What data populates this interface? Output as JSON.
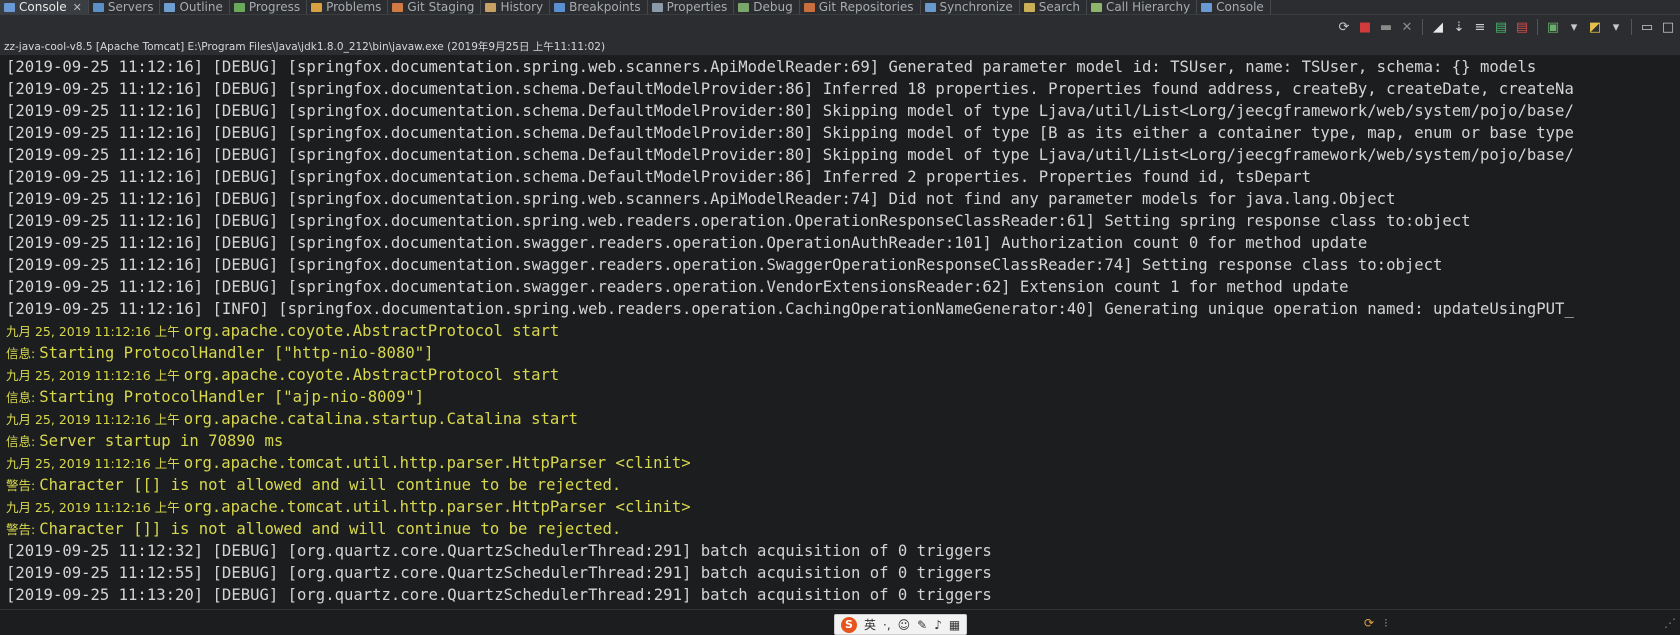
{
  "tabs": [
    {
      "label": "Console",
      "icon": "console-icon",
      "active": true,
      "color": "#6a9ad6"
    },
    {
      "label": "Servers",
      "icon": "servers-icon",
      "color": "#5b8fc8"
    },
    {
      "label": "Outline",
      "icon": "outline-icon",
      "color": "#6f9fd0"
    },
    {
      "label": "Progress",
      "icon": "progress-icon",
      "color": "#6aa85c"
    },
    {
      "label": "Problems",
      "icon": "problems-icon",
      "color": "#d8a040"
    },
    {
      "label": "Git Staging",
      "icon": "git-staging-icon",
      "color": "#d07a45"
    },
    {
      "label": "History",
      "icon": "history-icon",
      "color": "#c7a064"
    },
    {
      "label": "Breakpoints",
      "icon": "breakpoints-icon",
      "color": "#5a8fd0"
    },
    {
      "label": "Properties",
      "icon": "properties-icon",
      "color": "#8a9aa8"
    },
    {
      "label": "Debug",
      "icon": "debug-icon",
      "color": "#7aa86a"
    },
    {
      "label": "Git Repositories",
      "icon": "git-repositories-icon",
      "color": "#c96f3e"
    },
    {
      "label": "Synchronize",
      "icon": "synchronize-icon",
      "color": "#6a9acb"
    },
    {
      "label": "Search",
      "icon": "search-icon",
      "color": "#c9b056"
    },
    {
      "label": "Call Hierarchy",
      "icon": "call-hierarchy-icon",
      "color": "#8fb56c"
    },
    {
      "label": "Console",
      "icon": "console-icon",
      "color": "#6a9ad6"
    }
  ],
  "toolbar_buttons": [
    {
      "name": "refresh-icon",
      "glyph": "⟳",
      "color": "#c8c8c8"
    },
    {
      "name": "terminate-icon",
      "glyph": "■",
      "color": "#d23b3b"
    },
    {
      "name": "remove-launch-icon",
      "glyph": "▬",
      "color": "#8a8a8a"
    },
    {
      "name": "remove-all-terminated-icon",
      "glyph": "✕",
      "color": "#8a8a8a"
    },
    {
      "sep": true
    },
    {
      "name": "clear-console-icon",
      "glyph": "◢",
      "color": "#e8e8e8"
    },
    {
      "name": "scroll-lock-icon",
      "glyph": "⇣",
      "color": "#d8d8d8"
    },
    {
      "name": "word-wrap-icon",
      "glyph": "≡",
      "color": "#d0d0d0"
    },
    {
      "name": "show-on-output-icon",
      "glyph": "▤",
      "color": "#4bb06a"
    },
    {
      "name": "show-on-error-icon",
      "glyph": "▤",
      "color": "#d24b4b"
    },
    {
      "sep": true
    },
    {
      "name": "pin-console-icon",
      "glyph": "▣",
      "color": "#68b06a"
    },
    {
      "name": "display-selected-console-icon",
      "glyph": "▾",
      "color": "#c8c8c8"
    },
    {
      "name": "open-console-icon",
      "glyph": "◩",
      "color": "#e4c04a"
    },
    {
      "name": "open-console-menu-icon",
      "glyph": "▾",
      "color": "#c8c8c8"
    },
    {
      "sep": true
    },
    {
      "name": "minimize-view-icon",
      "glyph": "▭",
      "color": "#c8c8c8"
    },
    {
      "name": "maximize-view-icon",
      "glyph": "□",
      "color": "#c8c8c8"
    }
  ],
  "process_label": "zz-java-cool-v8.5 [Apache Tomcat] E:\\Program Files\\Java\\jdk1.8.0_212\\bin\\javaw.exe (2019年9月25日 上午11:11:02)",
  "console_lines": [
    {
      "text": "[2019-09-25 11:12:16] [DEBUG] [springfox.documentation.spring.web.scanners.ApiModelReader:69] Generated parameter model id: TSUser, name: TSUser, schema: {} models"
    },
    {
      "text": "[2019-09-25 11:12:16] [DEBUG] [springfox.documentation.schema.DefaultModelProvider:86] Inferred 18 properties. Properties found address, createBy, createDate, createNa"
    },
    {
      "text": "[2019-09-25 11:12:16] [DEBUG] [springfox.documentation.schema.DefaultModelProvider:80] Skipping model of type Ljava/util/List<Lorg/jeecgframework/web/system/pojo/base/"
    },
    {
      "text": "[2019-09-25 11:12:16] [DEBUG] [springfox.documentation.schema.DefaultModelProvider:80] Skipping model of type [B as its either a container type, map, enum or base type"
    },
    {
      "text": "[2019-09-25 11:12:16] [DEBUG] [springfox.documentation.schema.DefaultModelProvider:80] Skipping model of type Ljava/util/List<Lorg/jeecgframework/web/system/pojo/base/"
    },
    {
      "text": "[2019-09-25 11:12:16] [DEBUG] [springfox.documentation.schema.DefaultModelProvider:86] Inferred 2 properties. Properties found id, tsDepart"
    },
    {
      "text": "[2019-09-25 11:12:16] [DEBUG] [springfox.documentation.spring.web.scanners.ApiModelReader:74] Did not find any parameter models for java.lang.Object"
    },
    {
      "text": "[2019-09-25 11:12:16] [DEBUG] [springfox.documentation.spring.web.readers.operation.OperationResponseClassReader:61] Setting spring response class to:object"
    },
    {
      "text": "[2019-09-25 11:12:16] [DEBUG] [springfox.documentation.swagger.readers.operation.OperationAuthReader:101] Authorization count 0 for method update"
    },
    {
      "text": "[2019-09-25 11:12:16] [DEBUG] [springfox.documentation.swagger.readers.operation.SwaggerOperationResponseClassReader:74] Setting response class to:object"
    },
    {
      "text": "[2019-09-25 11:12:16] [DEBUG] [springfox.documentation.swagger.readers.operation.VendorExtensionsReader:62] Extension count 1 for method update"
    },
    {
      "text": "[2019-09-25 11:12:16] [INFO] [springfox.documentation.spring.web.readers.operation.CachingOperationNameGenerator:40] Generating unique operation named: updateUsingPUT_"
    },
    {
      "prefix": "九月 25, 2019 11:12:16 上午 ",
      "text": "org.apache.coyote.AbstractProtocol start",
      "err": true
    },
    {
      "prefix": "信息: ",
      "text": "Starting ProtocolHandler [\"http-nio-8080\"]",
      "err": true
    },
    {
      "prefix": "九月 25, 2019 11:12:16 上午 ",
      "text": "org.apache.coyote.AbstractProtocol start",
      "err": true
    },
    {
      "prefix": "信息: ",
      "text": "Starting ProtocolHandler [\"ajp-nio-8009\"]",
      "err": true
    },
    {
      "prefix": "九月 25, 2019 11:12:16 上午 ",
      "text": "org.apache.catalina.startup.Catalina start",
      "err": true
    },
    {
      "prefix": "信息: ",
      "text": "Server startup in 70890 ms",
      "err": true
    },
    {
      "prefix": "九月 25, 2019 11:12:16 上午 ",
      "text": "org.apache.tomcat.util.http.parser.HttpParser <clinit>",
      "err": true
    },
    {
      "prefix": "警告: ",
      "text": "Character [[] is not allowed and will continue to be rejected.",
      "err": true
    },
    {
      "prefix": "九月 25, 2019 11:12:16 上午 ",
      "text": "org.apache.tomcat.util.http.parser.HttpParser <clinit>",
      "err": true
    },
    {
      "prefix": "警告: ",
      "text": "Character []] is not allowed and will continue to be rejected.",
      "err": true
    },
    {
      "text": "[2019-09-25 11:12:32] [DEBUG] [org.quartz.core.QuartzSchedulerThread:291] batch acquisition of 0 triggers"
    },
    {
      "text": "[2019-09-25 11:12:55] [DEBUG] [org.quartz.core.QuartzSchedulerThread:291] batch acquisition of 0 triggers"
    },
    {
      "text": "[2019-09-25 11:13:20] [DEBUG] [org.quartz.core.QuartzSchedulerThread:291] batch acquisition of 0 triggers"
    }
  ],
  "ime_bar": {
    "logo": "S",
    "mode": "英",
    "icons": [
      "punctuation-icon",
      "emoji-icon",
      "skin-icon",
      "voice-icon",
      "toolbox-icon"
    ]
  }
}
